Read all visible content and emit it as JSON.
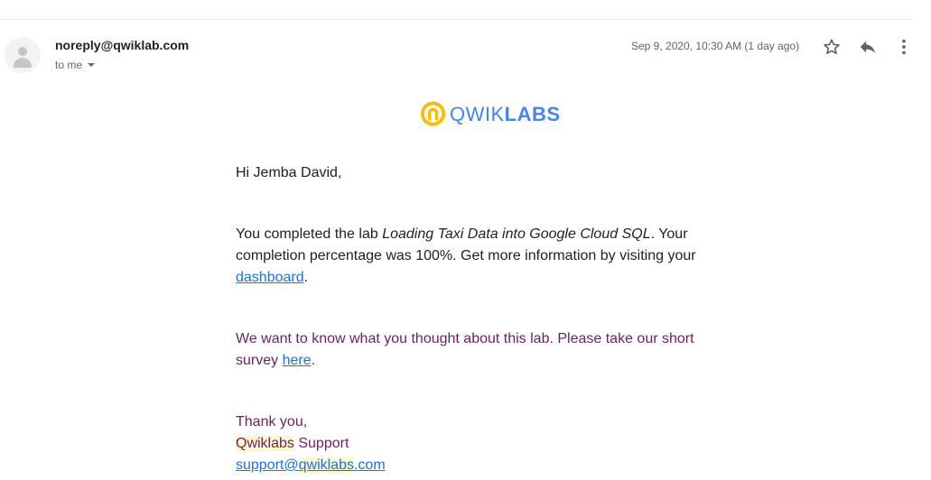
{
  "email": {
    "sender": "noreply@qwiklab.com",
    "recipient_label": "to me",
    "date": "Sep 9, 2020, 10:30 AM (1 day ago)"
  },
  "icons": {
    "star": "star-icon",
    "reply": "reply-icon",
    "more": "more-vert-icon",
    "avatar": "person-icon"
  },
  "logo": {
    "word_light": "QWIK",
    "word_bold": "LABS",
    "colors": {
      "ring": "#fbbc05",
      "text": "#4285f4"
    }
  },
  "body": {
    "greeting": "Hi Jemba David,",
    "p1_before": "You completed the lab ",
    "p1_lab": "Loading Taxi Data into Google Cloud SQL",
    "p1_middle": ". Your completion percentage was 100%. Get more information by visiting your ",
    "p1_link": "dashboard",
    "p1_end": ".",
    "p2_before": "We want to know what you thought about this lab. Please take our short survey ",
    "p2_link": "here",
    "p2_end": ".",
    "signoff": "Thank you,",
    "sig_hl": "Qwiklabs",
    "sig_rest": " Support",
    "email_user": "support@",
    "email_hl": "qwiklabs",
    "email_tld": ".com"
  },
  "colors": {
    "accent_link": "#1a73e8",
    "survey_text": "#6d1f64",
    "highlight": "#fdf8c7"
  }
}
